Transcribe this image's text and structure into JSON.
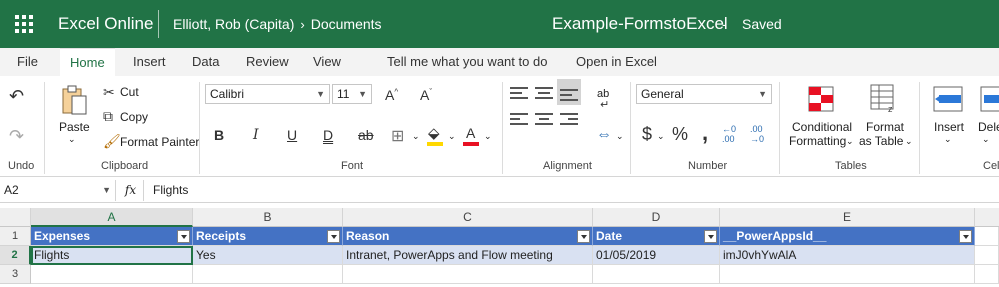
{
  "titlebar": {
    "app_name": "Excel Online",
    "breadcrumb_owner": "Elliott, Rob (Capita)",
    "breadcrumb_folder": "Documents",
    "doc_title": "Example-FormstoExcel",
    "dash": "-",
    "status": "Saved"
  },
  "tabs": {
    "file": "File",
    "home": "Home",
    "insert": "Insert",
    "data": "Data",
    "review": "Review",
    "view": "View",
    "tell_me": "Tell me what you want to do",
    "open_in_excel": "Open in Excel",
    "active": "Home"
  },
  "ribbon": {
    "undo_group": "Undo",
    "clipboard": {
      "paste": "Paste",
      "cut": "Cut",
      "copy": "Copy",
      "format_painter": "Format Painter",
      "group": "Clipboard"
    },
    "font": {
      "name": "Calibri",
      "size": "11",
      "bold": "B",
      "italic": "I",
      "underline": "U",
      "double_underline": "D",
      "strike": "ab",
      "grow": "A",
      "shrink": "A",
      "font_color": "A",
      "group": "Font"
    },
    "alignment": {
      "group": "Alignment",
      "wrap": "ab"
    },
    "number": {
      "format": "General",
      "currency": "$",
      "percent": "%",
      "comma": ",",
      "inc_dec_a": "←0",
      "inc_dec_a2": ".00",
      "inc_dec_b": ".00",
      "inc_dec_b2": "→0",
      "group": "Number"
    },
    "tables": {
      "conditional_1": "Conditional",
      "conditional_2": "Formatting",
      "format_table_1": "Format",
      "format_table_2": "as Table",
      "group": "Tables"
    },
    "cells": {
      "insert": "Insert",
      "delete": "Dele",
      "group": "Cell"
    },
    "colors": {
      "highlight": "#ffd800",
      "font_color": "#e81123"
    }
  },
  "formula_bar": {
    "name_box": "A2",
    "fx": "fx",
    "value": "Flights"
  },
  "sheet": {
    "columns": [
      "A",
      "B",
      "C",
      "D",
      "E"
    ],
    "selected_column": "A",
    "rows": [
      "1",
      "2",
      "3"
    ],
    "selected_row": "2",
    "header": [
      "Expenses",
      "Receipts",
      "Reason",
      "Date",
      "__PowerAppsId__"
    ],
    "data": [
      [
        "Flights",
        "Yes",
        "Intranet, PowerApps and Flow meeting",
        "01/05/2019",
        "imJ0vhYwAlA"
      ]
    ],
    "colors": {
      "table_header": "#4472c4",
      "band": "#d9e1f2",
      "accent": "#217346"
    }
  }
}
